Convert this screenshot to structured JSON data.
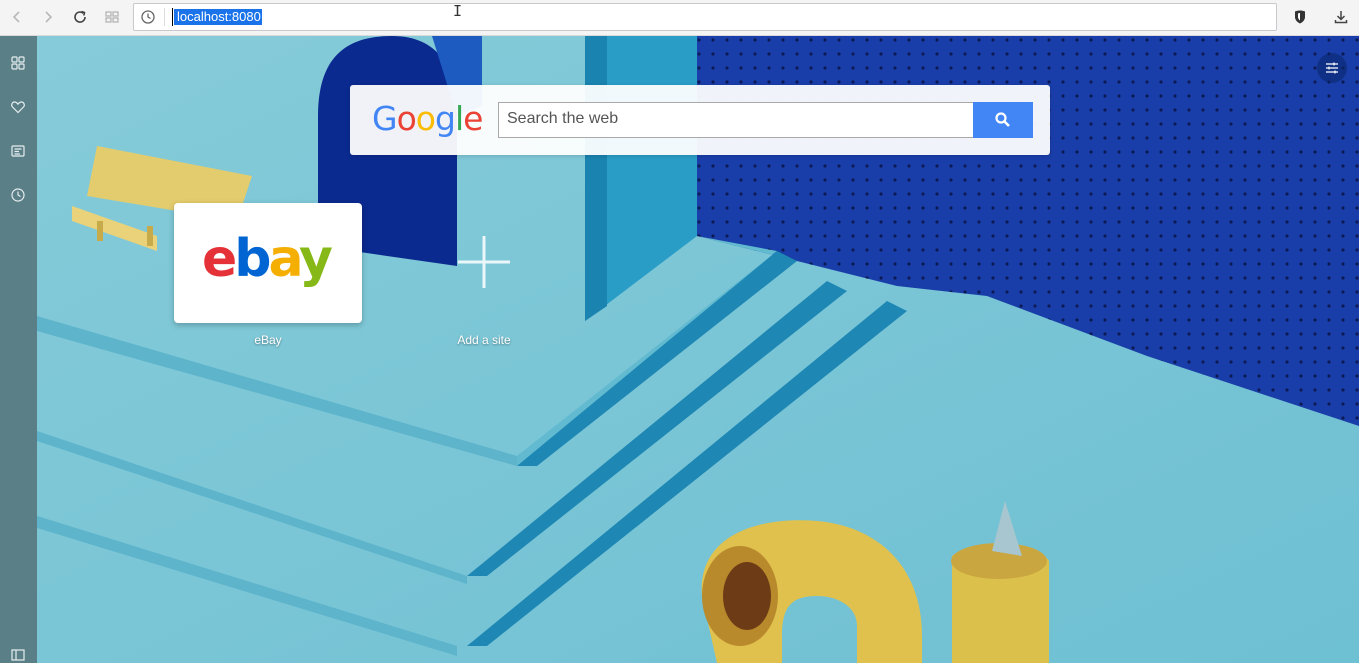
{
  "browser": {
    "back_icon": "arrow-left-icon",
    "forward_icon": "arrow-right-icon",
    "reload_icon": "reload-icon",
    "tabs_icon": "grid-icon",
    "history_icon": "clock-icon",
    "url": "localhost:8080",
    "vpn_icon": "shield-icon",
    "download_icon": "download-icon"
  },
  "sidebar": {
    "items": [
      {
        "icon": "speed-dial-icon"
      },
      {
        "icon": "heart-icon"
      },
      {
        "icon": "news-icon"
      },
      {
        "icon": "history-icon"
      },
      {
        "icon": "sidebar-toggle-icon"
      }
    ]
  },
  "search": {
    "logo": "Google",
    "placeholder": "Search the web",
    "button_icon": "search-icon"
  },
  "speed_dial": {
    "tiles": [
      {
        "logo": "ebay",
        "label": "eBay"
      },
      {
        "label": "Add a site"
      }
    ]
  },
  "colors": {
    "google_blue": "#4285F4",
    "google_red": "#EA4335",
    "google_yellow": "#FBBC05",
    "google_green": "#34A853",
    "ebay_red": "#E53238",
    "ebay_blue": "#0064D2",
    "ebay_yellow": "#F5AF02",
    "ebay_green": "#86B817"
  }
}
